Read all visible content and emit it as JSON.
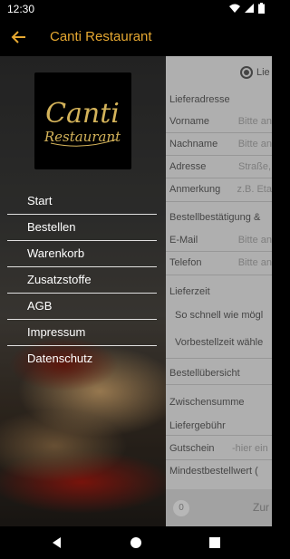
{
  "status_bar": {
    "time": "12:30",
    "icons": [
      "wifi-icon",
      "signal-icon",
      "battery-icon"
    ]
  },
  "app_bar": {
    "title": "Canti Restaurant",
    "back_icon": "back-arrow-icon",
    "accent": "#e6a831"
  },
  "drawer": {
    "logo": {
      "line1": "Canti",
      "line2": "Restaurant"
    },
    "menu": [
      {
        "label": "Start"
      },
      {
        "label": "Bestellen"
      },
      {
        "label": "Warenkorb"
      },
      {
        "label": "Zusatzstoffe"
      },
      {
        "label": "AGB"
      },
      {
        "label": "Impressum"
      },
      {
        "label": "Datenschutz"
      }
    ]
  },
  "form": {
    "radio_label": "Lie",
    "lieferadresse": "Lieferadresse",
    "fields": [
      {
        "label": "Vorname",
        "placeholder": "Bitte an"
      },
      {
        "label": "Nachname",
        "placeholder": "Bitte an"
      },
      {
        "label": "Adresse",
        "placeholder": "Straße,"
      },
      {
        "label": "Anmerkung",
        "placeholder": "z.B. Eta"
      }
    ],
    "bestaetigung": "Bestellbestätigung &",
    "contact_fields": [
      {
        "label": "E-Mail",
        "placeholder": "Bitte an"
      },
      {
        "label": "Telefon",
        "placeholder": "Bitte an"
      }
    ],
    "lieferzeit": "Lieferzeit",
    "time_options": [
      "So schnell wie mögl",
      "Vorbestellzeit wähle"
    ],
    "bestelluebersicht": "Bestellübersicht",
    "zwischensumme": "Zwischensumme",
    "liefergebuehr": "Liefergebühr",
    "gutschein_label": "Gutschein",
    "gutschein_placeholder": "-hier ein",
    "mindestbestellwert": "Mindestbestellwert (",
    "bottom": {
      "count": "0",
      "button": "Zur"
    }
  },
  "nav_bar": {
    "icons": [
      "back-triangle-icon",
      "home-circle-icon",
      "recents-square-icon"
    ]
  }
}
